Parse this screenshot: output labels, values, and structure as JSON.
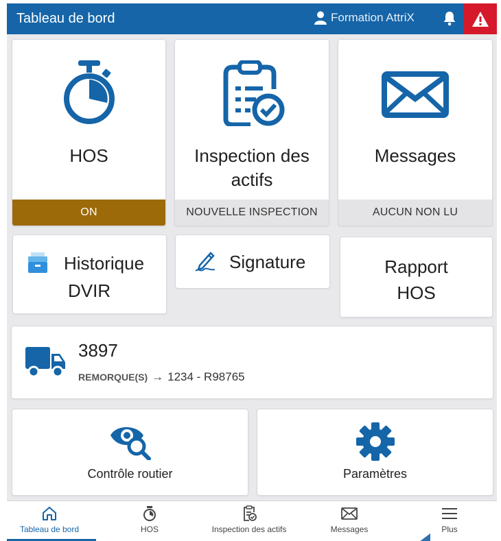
{
  "header": {
    "title": "Tableau de bord",
    "user_name": "Formation AttriX",
    "colors": {
      "bar": "#1565a8",
      "alert": "#d5192b"
    }
  },
  "tiles": {
    "hos": {
      "label": "HOS",
      "status": "ON",
      "icon": "stopwatch-icon"
    },
    "inspection": {
      "label_line1": "Inspection des",
      "label_line2": "actifs",
      "status": "NOUVELLE INSPECTION",
      "icon": "clipboard-check-icon"
    },
    "messages": {
      "label": "Messages",
      "status": "AUCUN NON LU",
      "icon": "envelope-icon"
    }
  },
  "shortcuts": {
    "dvir": {
      "label_line1": "Historique",
      "label_line2": "DVIR",
      "icon": "archive-box-icon"
    },
    "signature": {
      "label": "Signature",
      "icon": "pen-signature-icon"
    },
    "rapport": {
      "label_line1": "Rapport",
      "label_line2": "HOS"
    }
  },
  "vehicle": {
    "number": "3897",
    "trailer_label": "REMORQUE(S)",
    "arrow": "→",
    "trailer_value": "1234 - R98765",
    "icon": "truck-icon"
  },
  "actions": {
    "roadside": {
      "label": "Contrôle routier",
      "icon": "eye-search-icon"
    },
    "settings": {
      "label": "Paramètres",
      "icon": "gear-icon"
    }
  },
  "nav": {
    "items": [
      {
        "label": "Tableau de bord",
        "icon": "home-icon",
        "active": true
      },
      {
        "label": "HOS",
        "icon": "stopwatch-icon"
      },
      {
        "label": "Inspection des actifs",
        "icon": "clipboard-check-icon"
      },
      {
        "label": "Messages",
        "icon": "envelope-icon"
      },
      {
        "label": "Plus",
        "icon": "menu-icon"
      }
    ]
  }
}
